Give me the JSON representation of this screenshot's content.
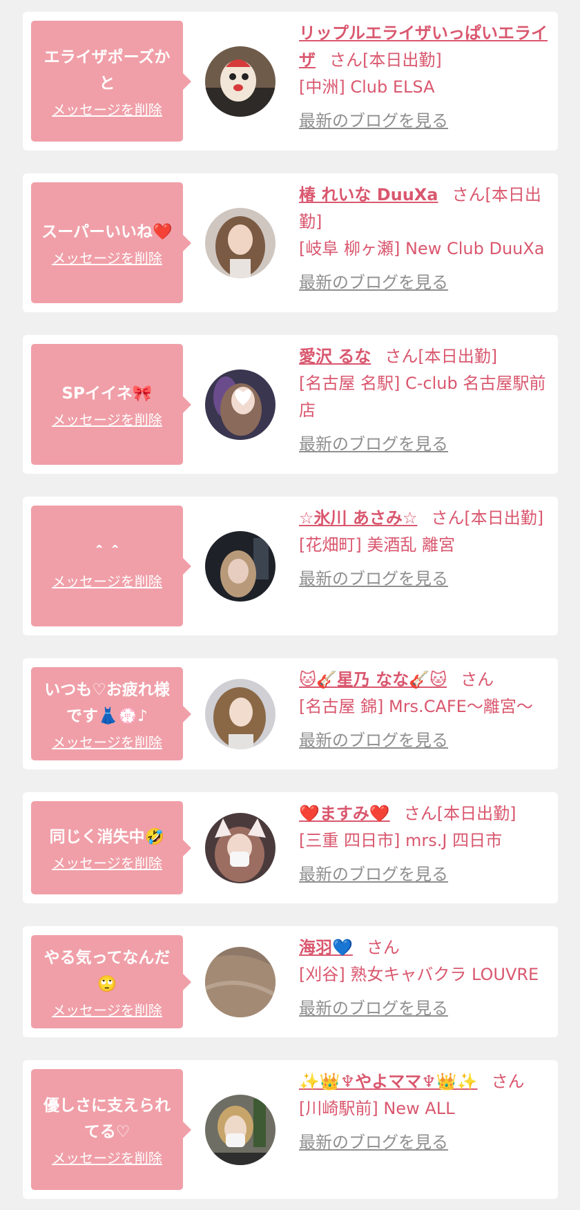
{
  "entries": [
    {
      "message": "エライザポーズかと",
      "delete_label": "メッセージを削除",
      "name": "リップルエライザいっぱいエライザ",
      "suffix": "さん[本日出勤]",
      "shop": "[中洲] Club ELSA",
      "blog_label": "最新のブログを見る"
    },
    {
      "message": "スーパーいいね❤️",
      "delete_label": "メッセージを削除",
      "name": "椿 れいな DuuXa",
      "suffix": "さん[本日出勤]",
      "shop": "[岐阜 柳ヶ瀬] New Club DuuXa",
      "blog_label": "最新のブログを見る"
    },
    {
      "message": "SPイイネ🎀",
      "delete_label": "メッセージを削除",
      "name": "愛沢 るな",
      "suffix": "さん[本日出勤]",
      "shop": "[名古屋 名駅] C-club 名古屋駅前店",
      "blog_label": "最新のブログを見る"
    },
    {
      "message": "＾＾",
      "delete_label": "メッセージを削除",
      "name": "☆氷川 あさみ☆",
      "suffix": "さん[本日出勤]",
      "shop": "[花畑町] 美酒乱 離宮",
      "blog_label": "最新のブログを見る"
    },
    {
      "message": "いつも♡お疲れ様です👗💮♪",
      "delete_label": "メッセージを削除",
      "name": "🐱🎸星乃 なな🎸🐱",
      "suffix": "さん",
      "shop": "[名古屋 錦] Mrs.CAFE～離宮～",
      "blog_label": "最新のブログを見る"
    },
    {
      "message": "同じく消失中🤣",
      "delete_label": "メッセージを削除",
      "name": "❤️ますみ❤️",
      "suffix": "さん[本日出勤]",
      "shop": "[三重 四日市] mrs.J 四日市",
      "blog_label": "最新のブログを見る"
    },
    {
      "message": "やる気ってなんだ🙄",
      "delete_label": "メッセージを削除",
      "name": "海羽💙",
      "suffix": "さん",
      "shop": "[刈谷] 熟女キャバクラ LOUVRE",
      "blog_label": "最新のブログを見る"
    },
    {
      "message": "優しさに支えられてる♡",
      "delete_label": "メッセージを削除",
      "name": "✨👑♆やよママ♆👑✨",
      "suffix": "さん",
      "shop": "[川崎駅前] New ALL",
      "blog_label": "最新のブログを見る"
    }
  ],
  "colors": {
    "background": "#f0f0f0",
    "bubble": "#f09fa8",
    "name": "#d9576e",
    "blog_link": "#8f8f8f"
  }
}
